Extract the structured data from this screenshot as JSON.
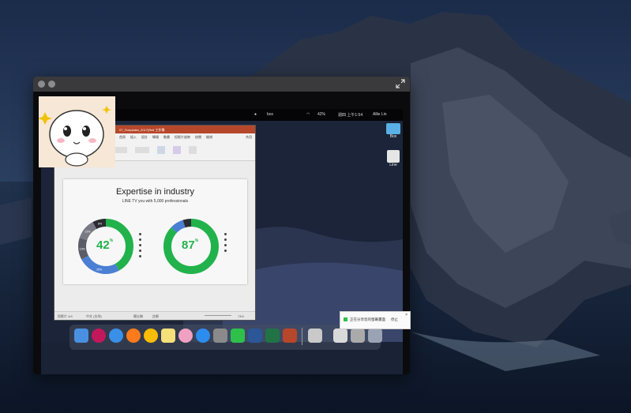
{
  "share_window": {
    "menubar": {
      "clock": "週四 上午1:54",
      "user": "Allie Lin",
      "battery": "42%",
      "box_label": "box"
    },
    "ppt": {
      "title": "07_Templates_2017(Rell 工作簿",
      "tabs": [
        "首頁",
        "插入",
        "設計",
        "轉場",
        "動畫",
        "投影片放映",
        "校閱",
        "檢視"
      ],
      "share_label": "共用",
      "slide": {
        "title": "Expertise in industry",
        "subtitle": "LINE TV you with 5,000 professionals"
      },
      "status": {
        "slide_counter": "投影片 4/4",
        "lang": "中文 (台灣)",
        "notes": "備忘稿",
        "comments": "註解",
        "zoom": "74%"
      }
    },
    "desktop_icons": [
      {
        "label": "Box"
      },
      {
        "label": "Line"
      }
    ],
    "notification": {
      "text": "正在分享您的螢幕畫面",
      "button": "停止"
    }
  },
  "chart_data": [
    {
      "type": "pie",
      "title": "Expertise in industry",
      "center_label": "42",
      "center_unit": "%",
      "slices": [
        {
          "label": "",
          "value": 42,
          "color": "#22b24c"
        },
        {
          "label": "",
          "value": 25,
          "color": "#4a7fd4"
        },
        {
          "label": "",
          "value": 13,
          "color": "#5c5c66"
        },
        {
          "label": "",
          "value": 12,
          "color": "#7a7a85"
        },
        {
          "label": "",
          "value": 8,
          "color": "#2b2b33"
        }
      ],
      "slice_labels": [
        "25%",
        "13%",
        "12%",
        "8%"
      ]
    },
    {
      "type": "pie",
      "center_label": "87",
      "center_unit": "%",
      "slices": [
        {
          "label": "",
          "value": 87,
          "color": "#22b24c"
        },
        {
          "label": "",
          "value": 8,
          "color": "#4a7fd4"
        },
        {
          "label": "",
          "value": 5,
          "color": "#2b2b33"
        }
      ]
    }
  ],
  "colors": {
    "accent": "#22b24c",
    "ppt_brand": "#b7472a"
  }
}
